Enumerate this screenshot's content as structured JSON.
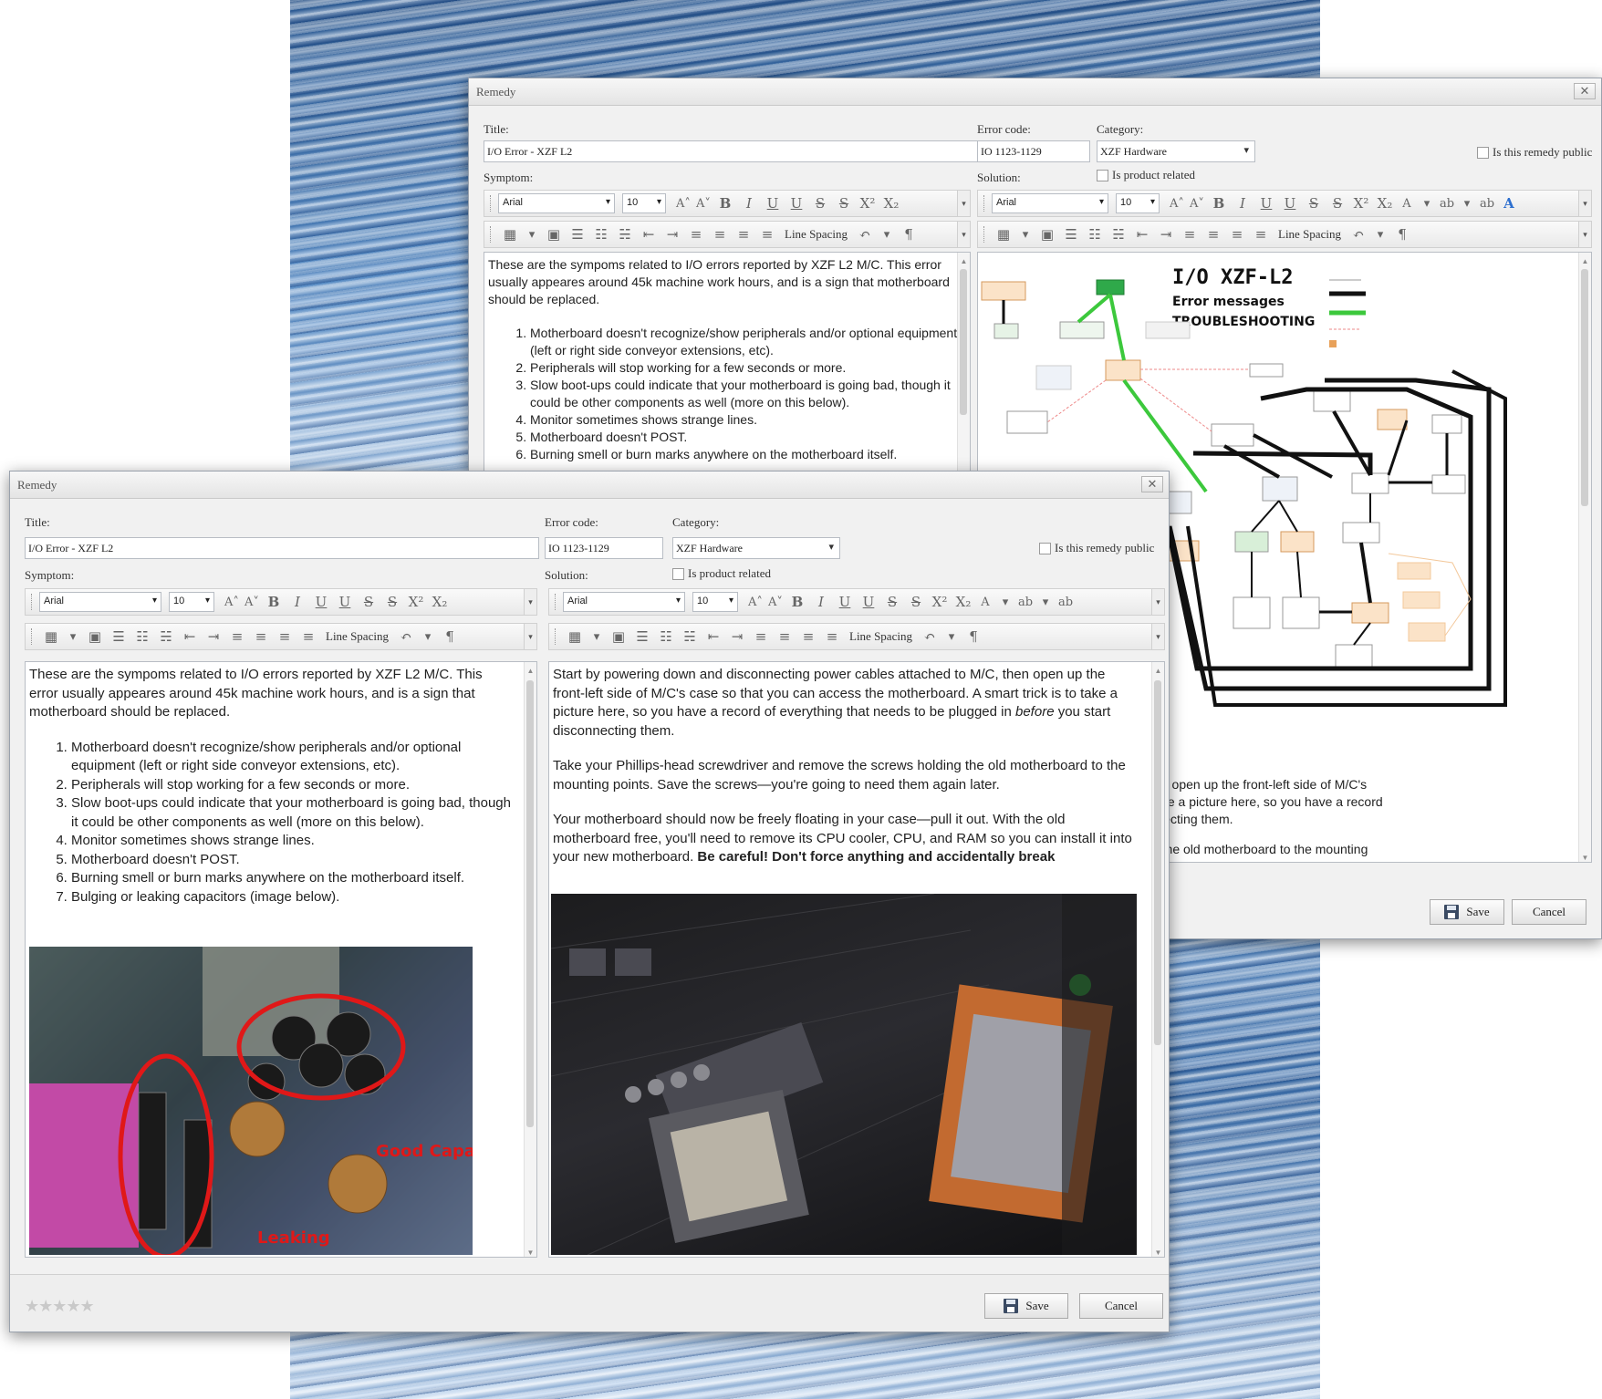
{
  "back_window": {
    "title": "Remedy",
    "close_glyph": "✕",
    "labels": {
      "title": "Title:",
      "error_code": "Error code:",
      "category": "Category:",
      "symptom": "Symptom:",
      "solution": "Solution:"
    },
    "title_value": "I/O Error - XZF L2",
    "error_code_value": "IO 1123-1129",
    "category_value": "XZF Hardware",
    "product_related_label": "Is product related",
    "public_label": "Is this remedy public",
    "toolbar": {
      "font": "Arial",
      "size": "10",
      "line_spacing": "Line Spacing"
    },
    "symptom_intro": "These are the sympoms related to I/O errors reported by XZF L2 M/C. This error usually appeares around 45k machine work hours, and is a sign that motherboard should be replaced.",
    "symptom_items": [
      "Motherboard doesn't recognize/show peripherals and/or optional equipment (left or right side conveyor extensions, etc).",
      "Peripherals will stop working for a few seconds or more.",
      "Slow boot-ups could indicate that your motherboard is going bad, though it could be other components as well (more on this below).",
      "Monitor sometimes shows strange lines.",
      "Motherboard doesn't POST.",
      "Burning smell or burn marks anywhere on the motherboard itself."
    ],
    "diagram": {
      "title": "I/O XZF-L2",
      "subtitle1": "Error messages",
      "subtitle2": "TROUBLESHOOTING"
    },
    "solution_lines": [
      "wer cables attached to M/C, then open up the front-left side of M/C's",
      "otherboard. A smart trick is to take a picture here, so you have a record",
      "gged in before you start disconnecting them.",
      "and remove the screws holding the old motherboard to the mounting"
    ],
    "save": "Save",
    "cancel": "Cancel"
  },
  "front_window": {
    "title": "Remedy",
    "close_glyph": "✕",
    "labels": {
      "title": "Title:",
      "error_code": "Error code:",
      "category": "Category:",
      "symptom": "Symptom:",
      "solution": "Solution:"
    },
    "title_value": "I/O Error - XZF L2",
    "error_code_value": "IO 1123-1129",
    "category_value": "XZF Hardware",
    "product_related_label": "Is product related",
    "public_label": "Is this remedy public",
    "toolbar": {
      "font": "Arial",
      "size": "10",
      "line_spacing": "Line Spacing"
    },
    "symptom_intro": "These are the sympoms related to I/O errors reported by XZF L2 M/C. This error usually appeares around 45k machine work hours, and is a sign that motherboard should be replaced.",
    "symptom_items": [
      "Motherboard doesn't recognize/show peripherals and/or optional equipment (left or right side conveyor extensions, etc).",
      "Peripherals will stop working for a few seconds or more.",
      "Slow boot-ups could indicate that your motherboard is going bad, though it could be other components as well (more on this below).",
      "Monitor sometimes shows strange lines.",
      "Motherboard doesn't POST.",
      "Burning smell or burn marks anywhere on the motherboard itself.",
      "Bulging or leaking capacitors (image below)."
    ],
    "photo_labels": {
      "good": "Good Capacitor",
      "leaking": "Leaking"
    },
    "solution_p1_a": "Start by powering down and disconnecting power cables attached to M/C, then open up the front-left side of M/C's case so that you can access the motherboard. A smart trick is to take a picture here, so you have a record of everything that needs to be plugged in ",
    "solution_p1_em": "before",
    "solution_p1_b": " you start disconnecting them.",
    "solution_p2": "Take your Phillips-head screwdriver and remove the screws holding the old motherboard to the mounting points. Save the screws—you're going to need them again later.",
    "solution_p3_a": "Your motherboard should now be freely floating in your case—pull it out. With the old motherboard free, you'll need to remove its CPU cooler, CPU, and RAM so you can install it into your new motherboard. ",
    "solution_p3_bold": "Be careful! Don't force anything and accidentally break",
    "rating": "★★★★★",
    "save": "Save",
    "cancel": "Cancel"
  }
}
